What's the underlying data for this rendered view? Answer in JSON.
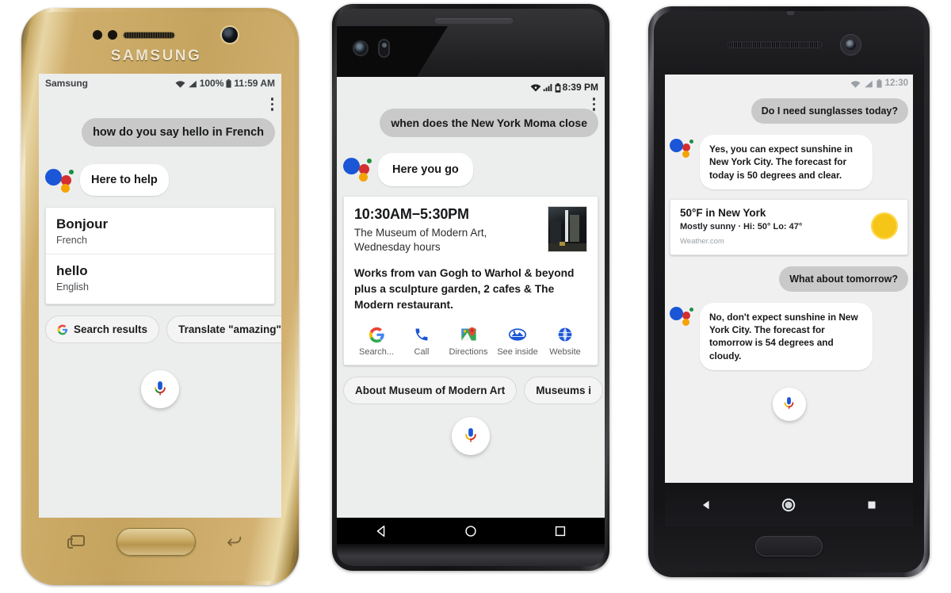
{
  "page": {
    "title": "Google Assistant on three Android phones"
  },
  "colors": {
    "assistant_blue": "#1a56d6",
    "assistant_red": "#d32f2f",
    "assistant_yellow": "#f5a302",
    "assistant_green": "#1d8f3d",
    "user_bubble": "#c9c9c9",
    "screen_bg": "#eceded",
    "sun_yellow": "#f5c518"
  },
  "phone1": {
    "device_brand": "SAMSUNG",
    "statusbar": {
      "carrier": "Samsung",
      "battery_percent": "100%",
      "time": "11:59 AM",
      "icons": [
        "wifi-icon",
        "signal-icon",
        "battery-icon"
      ]
    },
    "overflow_menu": "overflow-menu-icon",
    "conversation": [
      {
        "role": "user",
        "text": "how do you say hello in French"
      },
      {
        "role": "assistant",
        "text": "Here to help"
      }
    ],
    "translate_card": {
      "rows": [
        {
          "word": "Bonjour",
          "language": "French"
        },
        {
          "word": "hello",
          "language": "English"
        }
      ]
    },
    "chips": [
      {
        "label": "Search results",
        "icon": "google-g-icon"
      },
      {
        "label": "Translate \"amazing\"",
        "icon": null
      },
      {
        "label": "",
        "icon": null
      }
    ],
    "mic_button": "microphone-icon",
    "nav": {
      "recents": "recents-icon",
      "home": "home-button",
      "back": "back-icon"
    }
  },
  "phone2": {
    "statusbar": {
      "carrier": "",
      "time": "8:39 PM",
      "icons": [
        "wifi-icon",
        "signal-icon",
        "battery-icon"
      ]
    },
    "overflow_menu": "overflow-menu-icon",
    "conversation": [
      {
        "role": "user",
        "text": "when does the New York Moma close"
      },
      {
        "role": "assistant",
        "text": "Here you go"
      }
    ],
    "place_card": {
      "hours": "10:30AM−5:30PM",
      "name": "The Museum of Modern Art,",
      "day": "Wednesday hours",
      "description": "Works from van Gogh to Warhol & beyond plus a sculpture garden, 2 cafes & The Modern restaurant.",
      "thumbnail": "place-photo",
      "actions": [
        {
          "label": "Search...",
          "icon": "google-g-icon"
        },
        {
          "label": "Call",
          "icon": "phone-icon"
        },
        {
          "label": "Directions",
          "icon": "maps-pin-icon"
        },
        {
          "label": "See inside",
          "icon": "see-inside-icon"
        },
        {
          "label": "Website",
          "icon": "globe-icon"
        }
      ]
    },
    "chips": [
      {
        "label": "About Museum of Modern Art"
      },
      {
        "label": "Museums i"
      }
    ],
    "mic_button": "microphone-icon",
    "nav": {
      "back": "back-triangle-icon",
      "home": "home-circle-icon",
      "recents": "recents-square-icon"
    }
  },
  "phone3": {
    "statusbar": {
      "time": "12:30",
      "icons": [
        "wifi-icon",
        "signal-icon",
        "battery-icon"
      ]
    },
    "conversation": [
      {
        "role": "user",
        "text": "Do I need sunglasses today?"
      },
      {
        "role": "assistant",
        "text": "Yes, you can expect sunshine in New York City. The forecast for today is 50 degrees and clear."
      },
      {
        "role": "user",
        "text": "What about tomorrow?"
      },
      {
        "role": "assistant",
        "text": "No, don't expect sunshine in New York City. The forecast for tomorrow is 54 degrees and cloudy."
      }
    ],
    "weather_card": {
      "temperature": "50°F in New York",
      "conditions": "Mostly sunny · Hi: 50° Lo: 47°",
      "source": "Weather.com",
      "icon": "sun-icon"
    },
    "mic_button": "microphone-icon",
    "nav": {
      "back": "back-triangle-icon",
      "home": "home-circle-icon",
      "recents": "recents-square-icon"
    },
    "fingerprint": "fingerprint-sensor"
  }
}
